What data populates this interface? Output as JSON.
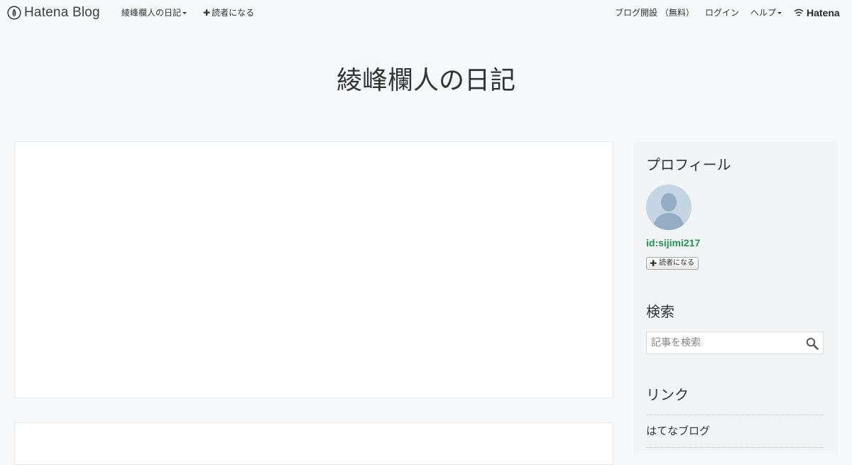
{
  "header": {
    "logo_text": "Hatena Blog",
    "blog_menu_label": "綾峰欄人の日記",
    "subscribe_label": "読者になる",
    "start_blog_label": "ブログ開設 （無料）",
    "login_label": "ログイン",
    "help_label": "ヘルプ",
    "brand_label": "Hatena"
  },
  "blog": {
    "title": "綾峰欄人の日記"
  },
  "sidebar": {
    "profile": {
      "title": "プロフィール",
      "user_id": "id:sijimi217",
      "subscribe_button": "読者になる"
    },
    "search": {
      "title": "検索",
      "placeholder": "記事を検索"
    },
    "links": {
      "title": "リンク",
      "items": [
        {
          "label": "はてなブログ"
        }
      ]
    }
  },
  "colors": {
    "background": "#f7f8fa",
    "id_link": "#1b9a4b",
    "avatar_bg": "#c6d5e3",
    "avatar_figure": "#94acc4"
  }
}
